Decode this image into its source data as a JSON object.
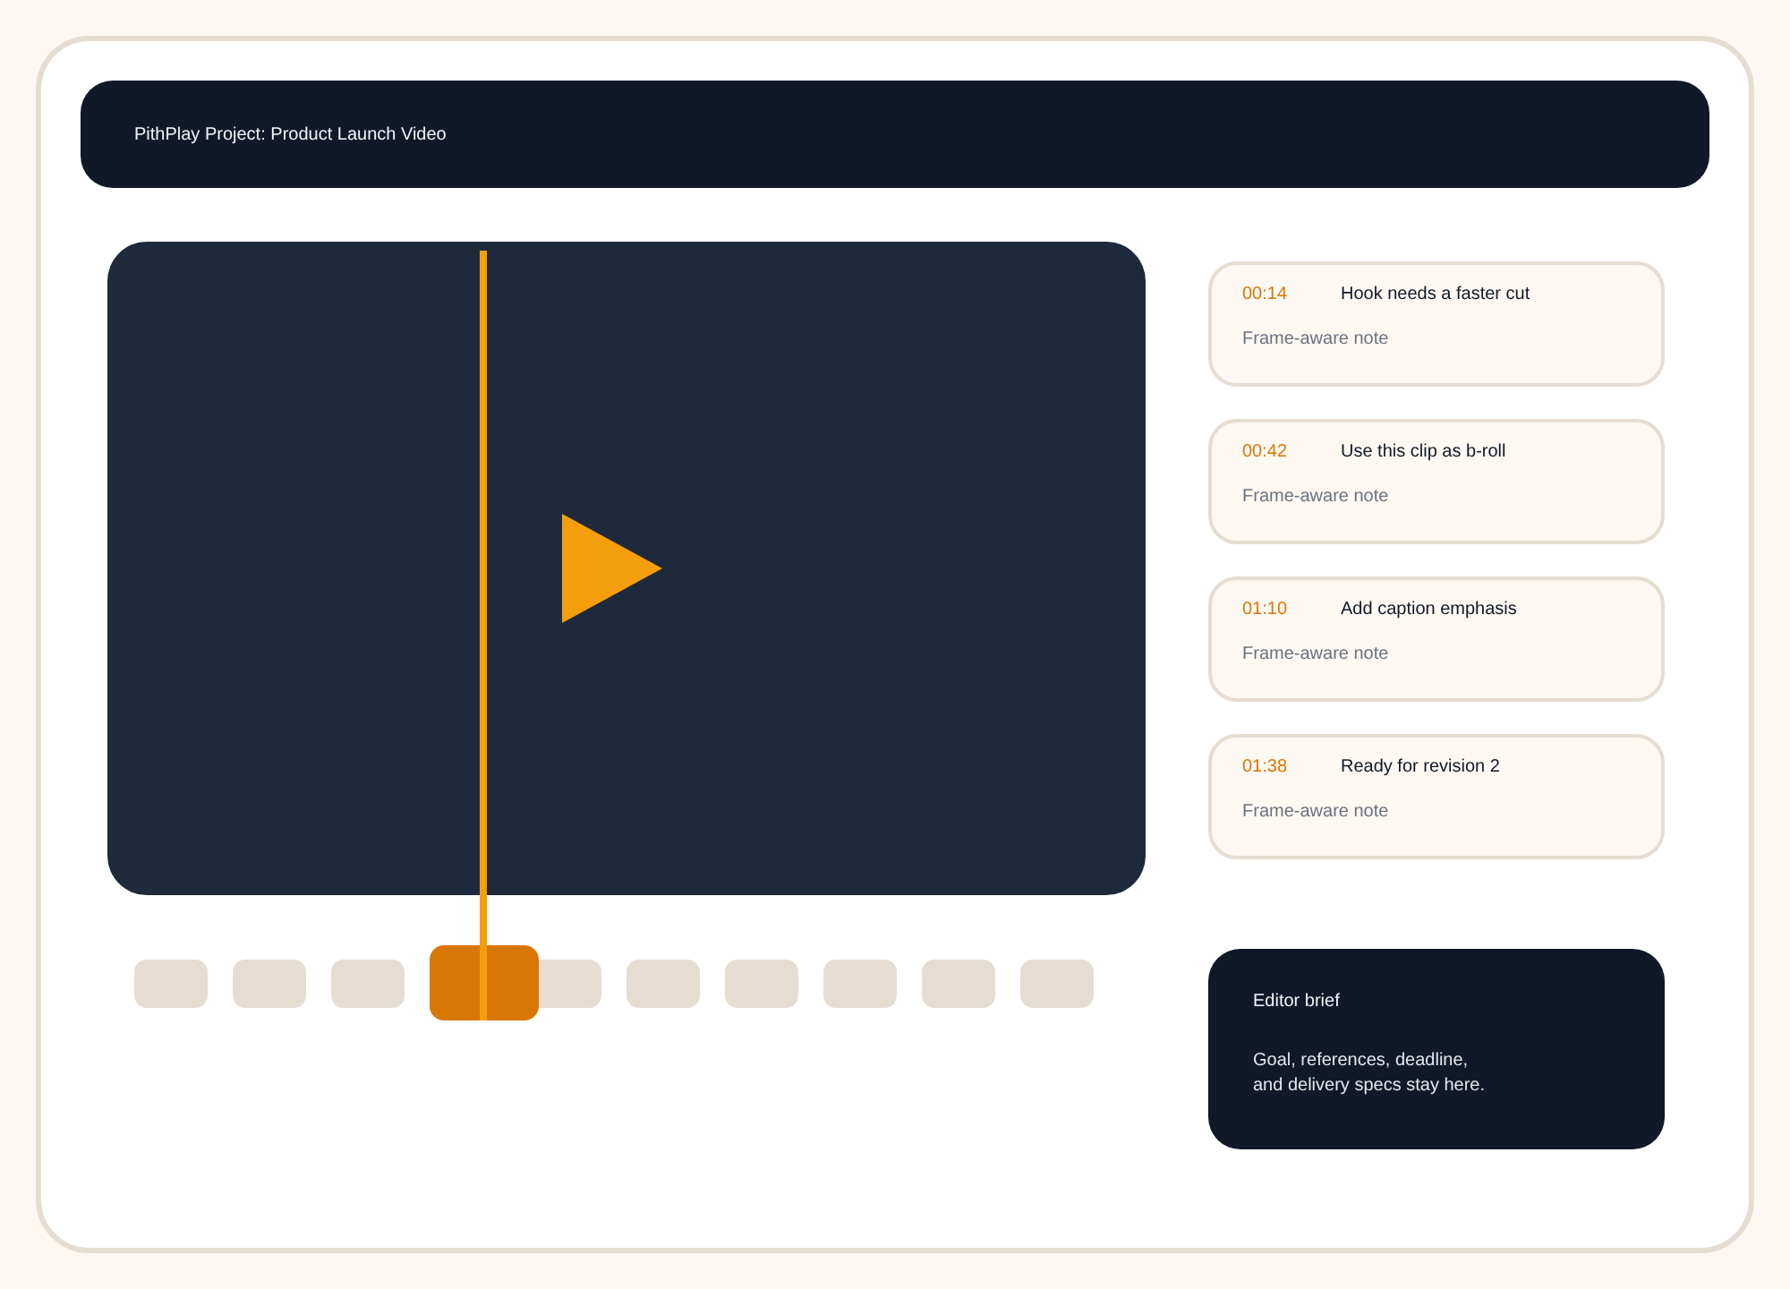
{
  "header": {
    "title": "PithPlay Project: Product Launch Video"
  },
  "video": {
    "playhead": {
      "visible": true
    }
  },
  "thumbnails": [
    {
      "selected": false
    },
    {
      "selected": false
    },
    {
      "selected": false
    },
    {
      "selected": true
    },
    {
      "selected": false
    },
    {
      "selected": false
    },
    {
      "selected": false
    },
    {
      "selected": false
    },
    {
      "selected": false
    },
    {
      "selected": false
    }
  ],
  "notes": [
    {
      "time": "00:14",
      "title": "Hook needs a faster cut",
      "subtitle": "Frame-aware note"
    },
    {
      "time": "00:42",
      "title": "Use this clip as b-roll",
      "subtitle": "Frame-aware note"
    },
    {
      "time": "01:10",
      "title": "Add caption emphasis",
      "subtitle": "Frame-aware note"
    },
    {
      "time": "01:38",
      "title": "Ready for revision 2",
      "subtitle": "Frame-aware note"
    }
  ],
  "brief": {
    "title": "Editor brief",
    "lines": [
      "Goal, references, deadline,",
      "and delivery specs stay here."
    ]
  }
}
